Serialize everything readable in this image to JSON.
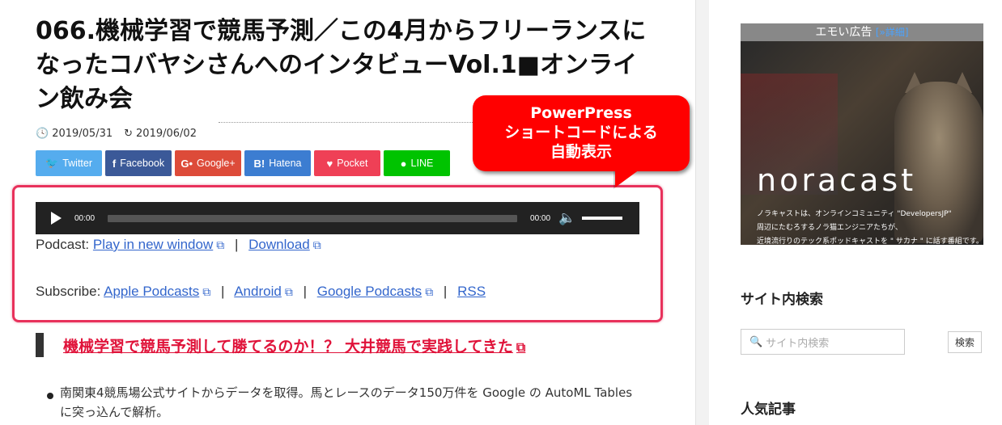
{
  "article": {
    "title": "066.機械学習で競馬予測／この4月からフリーランスになったコバヤシさんへのインタビューVol.1■オンライン飲み会",
    "published": "2019/05/31",
    "updated": "2019/06/02"
  },
  "share": [
    {
      "label": "Twitter",
      "icon": "twitter-icon",
      "glyph": "🐦",
      "color": "#55acee"
    },
    {
      "label": "Facebook",
      "icon": "facebook-icon",
      "glyph": "f",
      "color": "#3b5998"
    },
    {
      "label": "Google+",
      "icon": "googleplus-icon",
      "glyph": "G+",
      "color": "#dd4b39"
    },
    {
      "label": "Hatena",
      "icon": "hatena-icon",
      "glyph": "B!",
      "color": "#3c7dd1"
    },
    {
      "label": "Pocket",
      "icon": "pocket-icon",
      "glyph": "⛉",
      "color": "#ef4056"
    },
    {
      "label": "LINE",
      "icon": "line-icon",
      "glyph": "💬",
      "color": "#00c300"
    }
  ],
  "player": {
    "current_time": "00:00",
    "duration": "00:00"
  },
  "podcast": {
    "label": "Podcast:",
    "links": [
      "Play in new window",
      "Download"
    ]
  },
  "subscribe": {
    "label": "Subscribe:",
    "links": [
      "Apple Podcasts",
      "Android",
      "Google Podcasts",
      "RSS"
    ]
  },
  "callout": {
    "lines": [
      "PowerPress",
      "ショートコードによる",
      "自動表示"
    ]
  },
  "section_link": "機械学習で競馬予測して勝てるのか！？ 大井競馬で実践してきた",
  "bullet": "南関東4競馬場公式サイトからデータを取得。馬とレースのデータ150万件を Google の AutoML Tables に突っ込んで解析。",
  "sidebar": {
    "ad_title": "エモい広告",
    "ad_details": "[»詳細]",
    "ad_brand": "noracast",
    "ad_desc": [
      "ノラキャストは、オンラインコミュニティ \"DevelopersJP\"",
      "周辺にたむろするノラ猫エンジニアたちが、",
      "近境流行りのテック系ポッドキャストを \" サカナ \" に話す番組です。"
    ],
    "search_heading": "サイト内検索",
    "search_placeholder": "サイト内検索",
    "search_button": "検索",
    "popular_heading": "人気記事"
  },
  "colors": {
    "accent_red": "#e0133a",
    "link_blue": "#3366cc",
    "callout_red": "#ff0000"
  }
}
